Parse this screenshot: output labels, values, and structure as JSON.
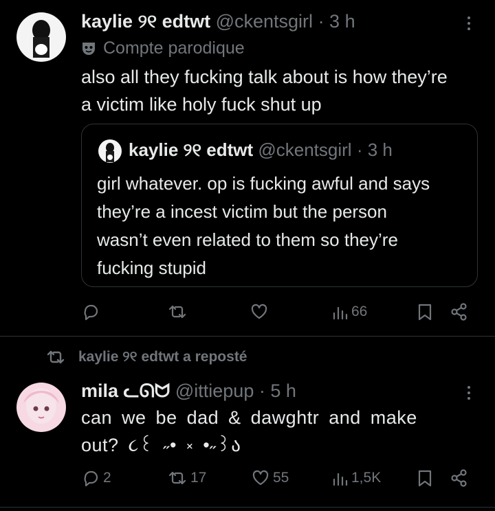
{
  "tweet1": {
    "name": "kaylie ୨୧ edtwt",
    "handle": "@ckentsgirl",
    "time": "· 3 h",
    "badge": "Compte parodique",
    "text": "also all they fucking talk about is how they’re\na victim like holy fuck shut up",
    "quote": {
      "name": "kaylie ୨୧ edtwt",
      "handle": "@ckentsgirl",
      "time": "· 3 h",
      "text": "girl whatever. op is fucking awful and says\nthey’re a incest victim but the person\nwasn’t even related to them so they’re\nfucking stupid"
    },
    "actions": {
      "replies": "",
      "reposts": "",
      "likes": "",
      "views": "66"
    }
  },
  "repost_banner": {
    "text": "kaylie ୨୧ edtwt a reposté"
  },
  "tweet2": {
    "name": "mila ᓚᘏᗢ",
    "handle": "@ittiepup",
    "time": "· 5 h",
    "text": "can we be dad & dawghtr and make\nout? ૮꒰ ˶• ༝ •˶꒱ა",
    "actions": {
      "replies": "2",
      "reposts": "17",
      "likes": "55",
      "views": "1,5K"
    }
  },
  "colors": {
    "background": "#000000",
    "text": "#e7e9ea",
    "muted": "#71767b",
    "border": "#2f3336"
  }
}
